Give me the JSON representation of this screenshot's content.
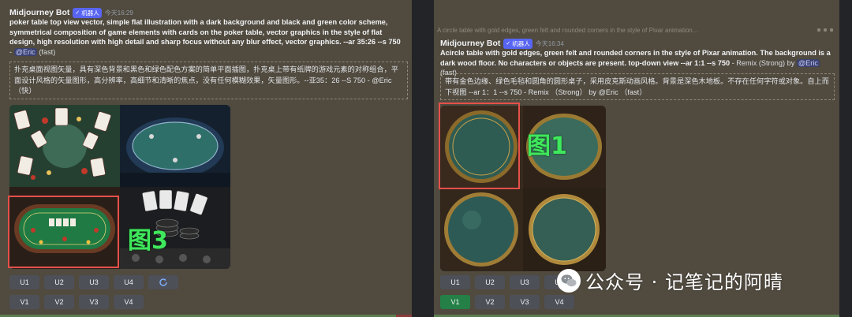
{
  "left": {
    "bot_name": "Midjourney Bot",
    "badge": "机器人",
    "timestamp": "今天16:29",
    "prompt_bold": "poker table top view vector, simple flat illustration with a dark background and black and green color scheme, symmetrical composition of game elements with cards on the poker table, vector graphics in the style of flat design, high resolution with high detail and sharp focus without any blur effect, vector graphics. --ar 35:26 --s 750",
    "prompt_sep": " - ",
    "mention": "@Eric",
    "prompt_tail": "(fast)",
    "translation": "扑克桌面视图矢量，具有深色背景和黑色和绿色配色方案的简单平面插图，扑克桌上带有纸牌的游戏元素的对称组合，平面设计风格的矢量图形，高分辨率，高细节和清晰的焦点，没有任何模糊效果，矢量图形。--亚35：26 --S 750 - @Eric（快）",
    "label": "图3",
    "upscale_buttons": [
      "U1",
      "U2",
      "U3",
      "U4"
    ],
    "variation_buttons": [
      "V1",
      "V2",
      "V3",
      "V4"
    ],
    "refresh_icon": "refresh-icon"
  },
  "right": {
    "top_faded_line": "A circle table with gold edges, green felt and rounded corners in the style of Pixar animation...",
    "bot_name": "Midjourney Bot",
    "badge": "机器人",
    "timestamp": "今天16:34",
    "prompt_bold": "Acircle table with gold edges, green felt and rounded corners in the style of Pixar animation. The background is a dark wood floor. No characters or objects are present. top-down view --ar 1:1 --s 750",
    "prompt_sep": " - Remix (Strong) by ",
    "mention": "@Eric",
    "prompt_tail": "(fast)",
    "translation": "带有金色边缘、绿色毛毡和圆角的圆形桌子，采用皮克斯动画风格。背景是深色木地板。不存在任何字符或对象。自上而下视图 --ar 1：1 --s 750 - Remix （Strong） by @Eric （fast）",
    "label": "图1",
    "upscale_buttons": [
      "U1",
      "U2",
      "U3",
      "U4"
    ],
    "variation_buttons": [
      "V1",
      "V2",
      "V3",
      "V4"
    ]
  },
  "watermark": {
    "text": "公众号 · 记笔记的阿晴",
    "icon": "wechat-icon"
  },
  "colors": {
    "panel": "#504a3f",
    "highlight": "#e6504b",
    "label_green": "#3fe85c",
    "active_button": "#248046",
    "mention": "#3c4270"
  }
}
